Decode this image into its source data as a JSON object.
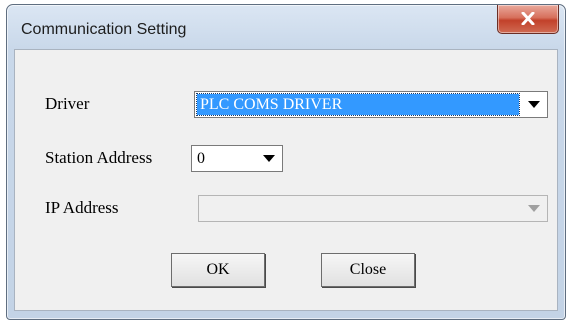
{
  "window": {
    "title": "Communication Setting",
    "close_icon": "close-x-icon"
  },
  "form": {
    "driver": {
      "label": "Driver",
      "selected": "PLC COMS DRIVER",
      "icon": "chevron-down-icon"
    },
    "station_address": {
      "label": "Station Address",
      "selected": "0",
      "icon": "chevron-down-icon"
    },
    "ip_address": {
      "label": "IP Address",
      "selected": "",
      "disabled": true,
      "icon": "chevron-down-icon"
    }
  },
  "buttons": {
    "ok": "OK",
    "close": "Close"
  },
  "colors": {
    "selection": "#3399ff",
    "close_button": "#c2412a"
  }
}
